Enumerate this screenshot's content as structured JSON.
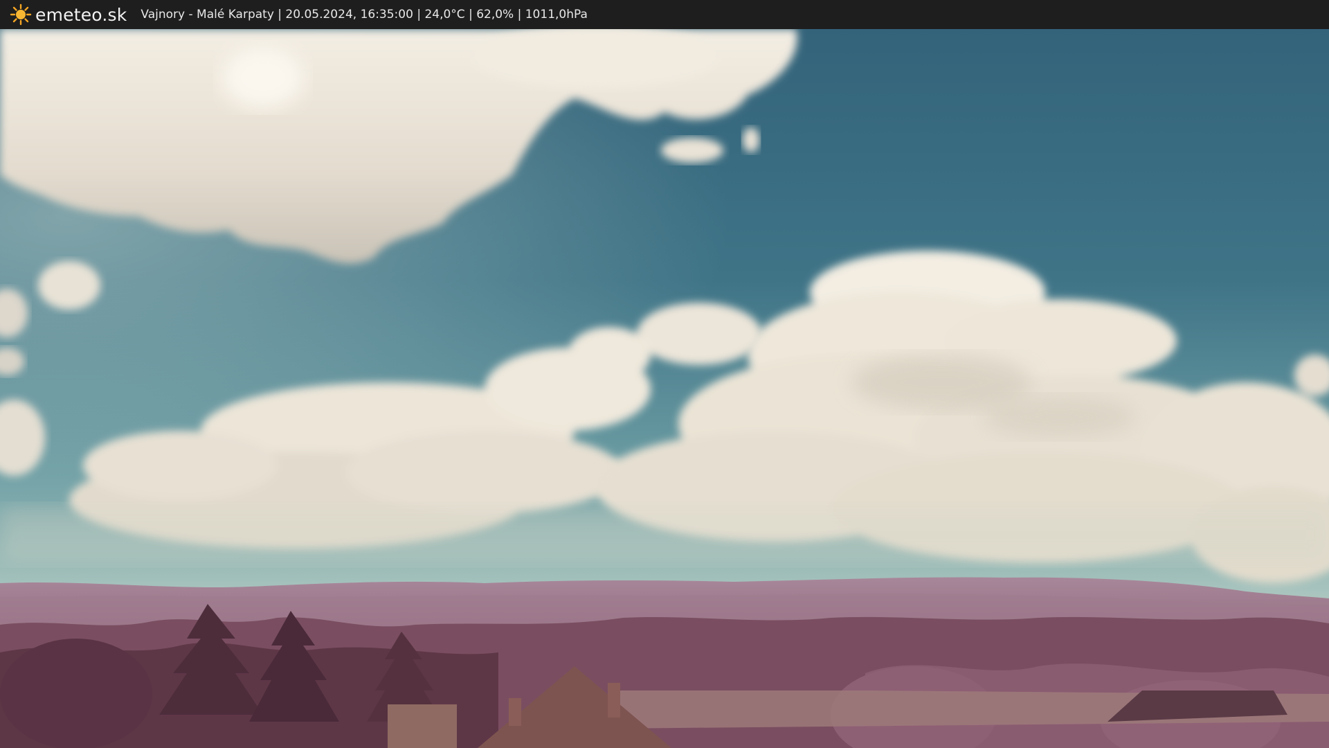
{
  "header": {
    "brand": "emeteo.sk",
    "caption": "Vajnory - Malé Karpaty | 20.05.2024, 16:35:00 | 24,0°C | 62,0% | 1011,0hPa",
    "logo_icon": "sun-icon"
  },
  "colors": {
    "bar": "#1e1e1e",
    "sky_top": "#3c6e84",
    "sky_bottom": "#a6c4be",
    "cloud": "#efe7dc",
    "hills": "#9b7388",
    "foliage": "#6a3d4e",
    "logo": "#f5a623"
  }
}
